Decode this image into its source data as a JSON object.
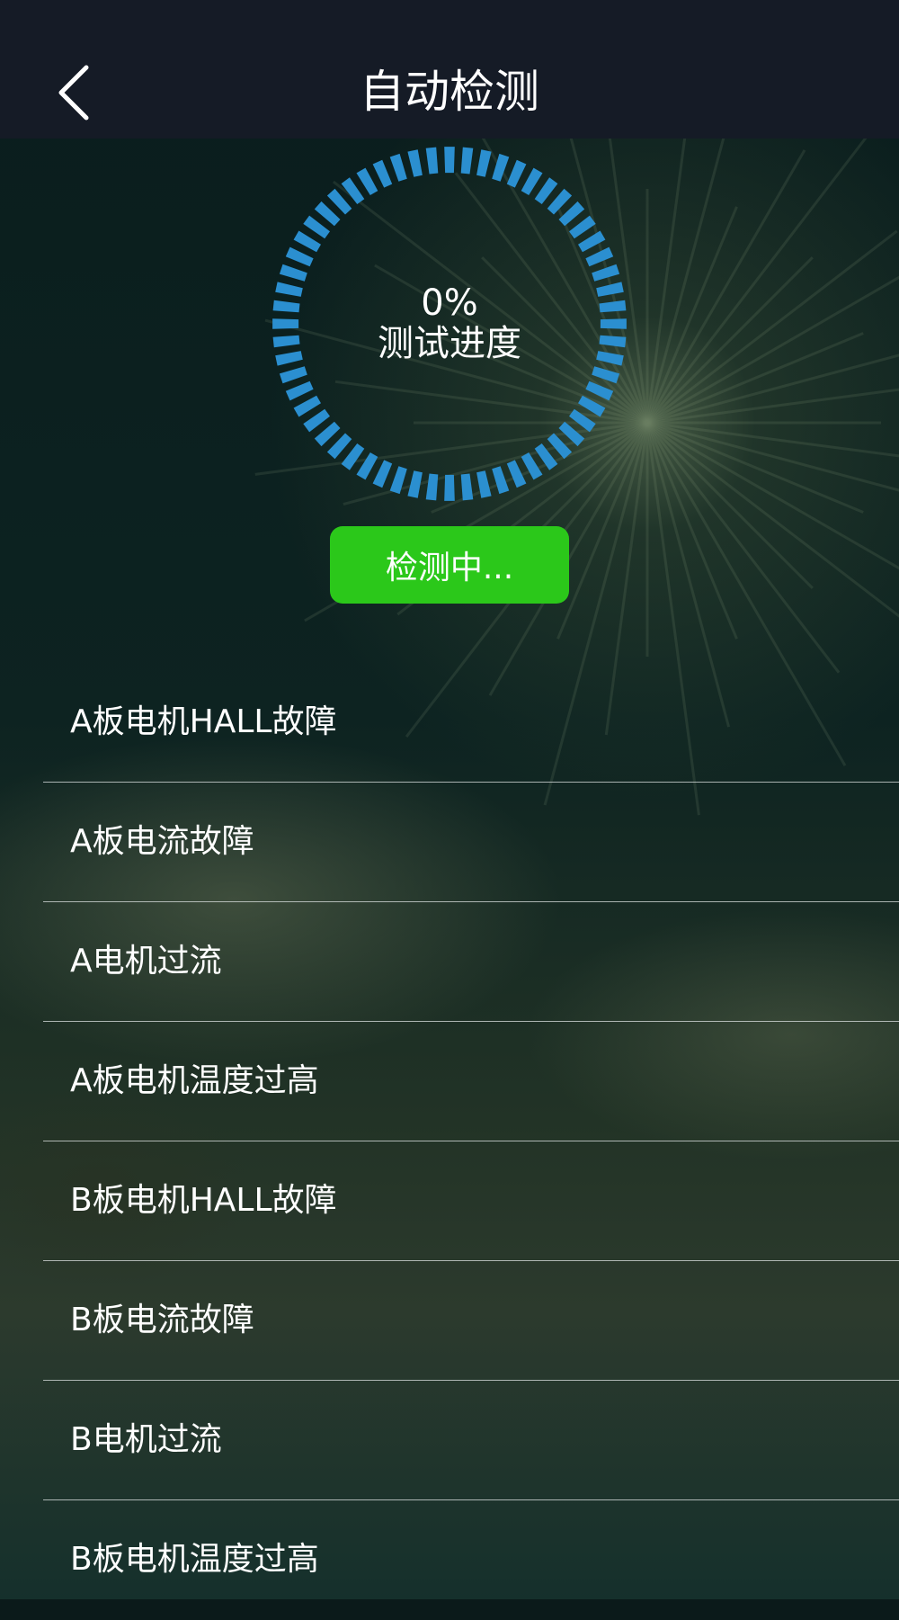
{
  "header": {
    "title": "自动检测",
    "back_icon": "chevron-left-icon"
  },
  "progress": {
    "value_text": "0%",
    "value": 0,
    "label": "测试进度",
    "ring_color": "#2b8fd0",
    "segments": 60
  },
  "status_button": {
    "label": "检测中...",
    "color": "#2bc81a"
  },
  "faults": [
    {
      "label": "A板电机HALL故障"
    },
    {
      "label": "A板电流故障"
    },
    {
      "label": "A电机过流"
    },
    {
      "label": "A板电机温度过高"
    },
    {
      "label": "B板电机HALL故障"
    },
    {
      "label": "B板电流故障"
    },
    {
      "label": "B电机过流"
    },
    {
      "label": "B板电机温度过高"
    }
  ]
}
